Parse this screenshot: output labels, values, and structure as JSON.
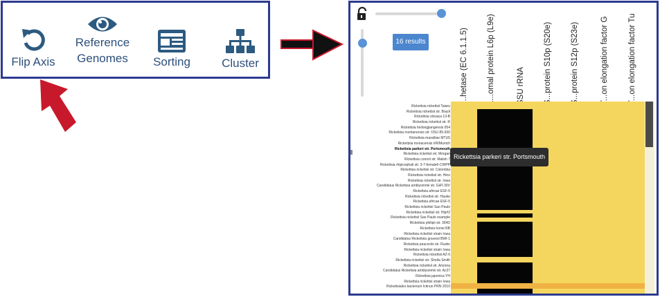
{
  "toolbar": {
    "flip_axis": "Flip Axis",
    "reference_line1": "Reference",
    "reference_line2": "Genomes",
    "sorting": "Sorting",
    "cluster": "Cluster",
    "icons": [
      "undo-icon",
      "eye-icon",
      "newspaper-icon",
      "sitemap-icon"
    ]
  },
  "heatmap": {
    "results_label": "16 results",
    "columns": [
      "l...hetase (EC 6.1.1.5)",
      "L...omal protein L6p (L9e)",
      "SSU rRNA",
      "S...protein S10p (S20e)",
      "S...protein S12p (S23e)",
      "T...on elongation factor G",
      "T...on elongation factor Tu"
    ],
    "rows": [
      "Rickettsia rickettsii Taiaru",
      "Rickettsia rickettsii str. Brazil",
      "Rickettsia slovaca 13-B",
      "Rickettsia rickettsii str. R",
      "Rickettsia heilongjiangensis 054",
      "Rickettsia montanensis str. OSU 85-930",
      "Rickettsia massiliae MTU5",
      "Rickettsia monacensis IrR/Munich",
      "Rickettsia parkeri str. Portsmouth",
      "Rickettsia rickettsii str. Morgan",
      "Rickettsia conorii str. Malish 7",
      "Rickettsia rhipicephali str. 3-7-female6-CWPP",
      "Rickettsia rickettsii str. Colombia",
      "Rickettsia rickettsii str. Hino",
      "Rickettsia rickettsii str. Iowa",
      "Candidatus Rickettsia amblyommii str. GAT-30V",
      "Rickettsia africae ESF-5",
      "Rickettsia rickettsii str. Hauke",
      "Rickettsia africae ESF-5",
      "Rickettsia rickettsii Sao Paulo",
      "Rickettsia rickettsii str. Hlp#2",
      "Rickettsia rickettsii Sao Paulo example",
      "Rickettsia philipii str. 364D",
      "Rickettsia honei RB",
      "Rickettsia rickettsii strain Iowa",
      "Candidatus Rickettsia gravesii BWI-1",
      "Rickettsia peacockii str. Rustic",
      "Rickettsia rickettsii strain Iowa",
      "Rickettsia rickettsii AZ-6",
      "Rickettsia rickettsii str. Sheila Smith",
      "Rickettsia rickettsii str. Arizona",
      "Candidatus Rickettsia amblyommii str. Ac37",
      "Rickettsia japonica YH",
      "Rickettsia rickettsii strain Iowa",
      "Rickettsiales bacterium Ictinun PRN 2010"
    ],
    "tooltip": "Rickettsia parkeri str. Portsmouth",
    "colors": {
      "cell_yellow": "#f4d65e",
      "cell_black": "#050505",
      "cell_orange": "#f0b244",
      "accent_blue": "#4b86cf",
      "border_navy": "#2b3a8f",
      "arrow_red": "#c8192c"
    },
    "slider_horizontal_level": 1.0,
    "slider_vertical_level": 0.15,
    "scroll_position": 0.0
  }
}
